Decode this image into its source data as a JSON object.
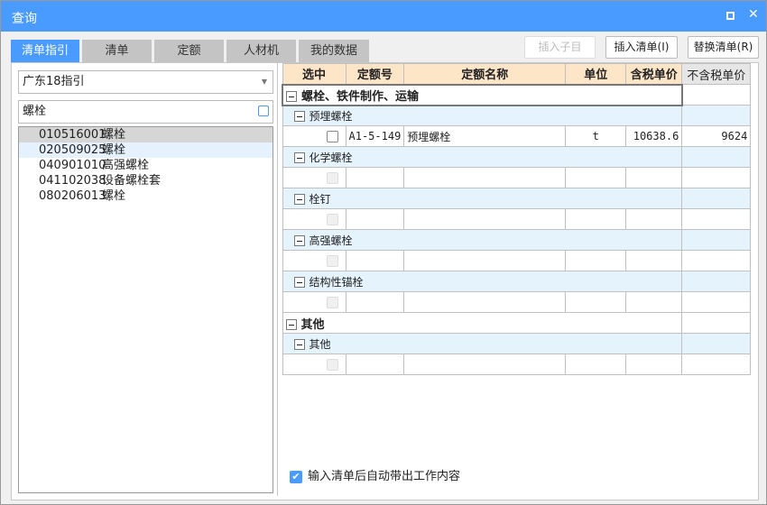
{
  "title": "查询",
  "tabs": [
    "清单指引",
    "清单",
    "定额",
    "人材机",
    "我的数据"
  ],
  "buttons": {
    "insert_sub": "插入子目",
    "insert_list": "插入清单(I)",
    "replace_list": "替换清单(R)"
  },
  "dropdown": {
    "value": "广东18指引"
  },
  "search": {
    "value": "螺栓"
  },
  "list": [
    {
      "code": "010516001",
      "name": "螺栓"
    },
    {
      "code": "020509025",
      "name": "螺栓"
    },
    {
      "code": "040901010",
      "name": "高强螺栓"
    },
    {
      "code": "041102038",
      "name": "设备螺栓套"
    },
    {
      "code": "080206013",
      "name": "螺栓"
    }
  ],
  "grid": {
    "headers": [
      "选中",
      "定额号",
      "定额名称",
      "单位",
      "含税单价",
      "不含税单价"
    ],
    "rows": [
      {
        "type": "group",
        "name": "螺栓、铁件制作、运输"
      },
      {
        "type": "sub",
        "name": "预埋螺栓"
      },
      {
        "type": "item",
        "code": "A1-5-149",
        "name": "预埋螺栓",
        "unit": "t",
        "price_tax": "10638.6",
        "price_notax": "9624"
      },
      {
        "type": "sub",
        "name": "化学螺栓"
      },
      {
        "type": "empty"
      },
      {
        "type": "sub",
        "name": "栓钉"
      },
      {
        "type": "empty"
      },
      {
        "type": "sub",
        "name": "高强螺栓"
      },
      {
        "type": "empty"
      },
      {
        "type": "sub",
        "name": "结构性锚栓"
      },
      {
        "type": "empty"
      },
      {
        "type": "group",
        "name": "其他"
      },
      {
        "type": "sub",
        "name": "其他"
      },
      {
        "type": "empty"
      }
    ]
  },
  "footer": {
    "auto_content_label": "输入清单后自动带出工作内容",
    "checked": true
  }
}
